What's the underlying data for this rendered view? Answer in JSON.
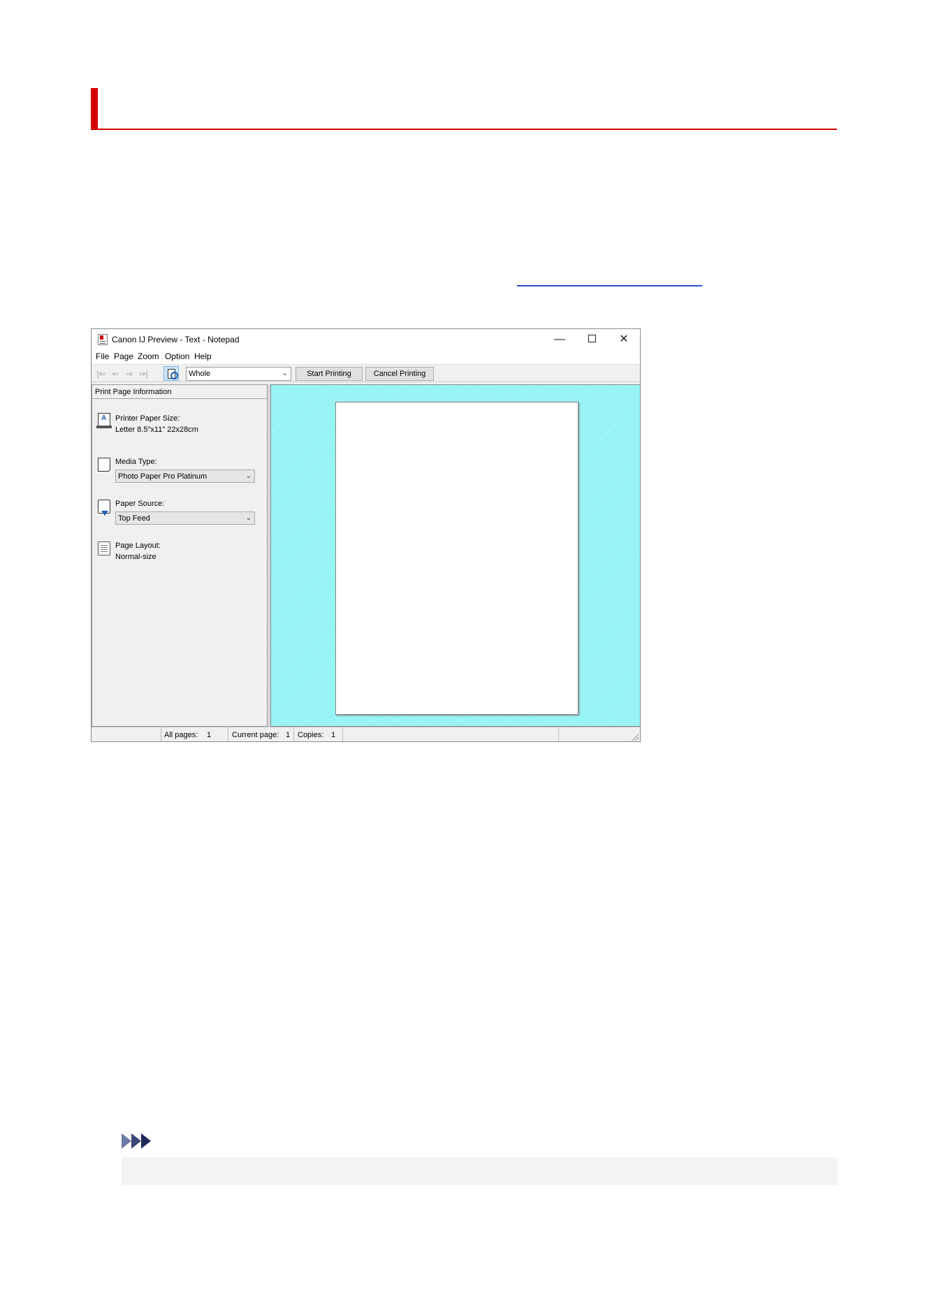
{
  "window": {
    "title": "Canon IJ Preview - Text - Notepad",
    "minimize_glyph": "—",
    "close_glyph": "✕"
  },
  "menu": [
    "File",
    "Page",
    "Zoom",
    "Option",
    "Help"
  ],
  "toolbar": {
    "nav_first": "|⇐",
    "nav_prev": "⇐",
    "nav_next": "⇒",
    "nav_last": "⇒|",
    "zoom_value": "Whole",
    "start_printing": "Start Printing",
    "cancel_printing": "Cancel Printing"
  },
  "info_panel": {
    "header": "Print Page Information",
    "printer_paper_size_label": "Printer Paper Size:",
    "printer_paper_size_value": "Letter 8.5\"x11\" 22x28cm",
    "media_type_label": "Media Type:",
    "media_type_value": "Photo Paper Pro Platinum",
    "paper_source_label": "Paper Source:",
    "paper_source_value": "Top Feed",
    "page_layout_label": "Page Layout:",
    "page_layout_value": "Normal-size"
  },
  "status_bar": {
    "all_pages_label": "All pages:",
    "all_pages_value": "1",
    "current_page_label": "Current page:",
    "current_page_value": "1",
    "copies_label": "Copies:",
    "copies_value": "1"
  },
  "colors": {
    "heading_accent": "#d40000",
    "link": "#2a4fd6",
    "preview_background": "#8ff3f3",
    "note_icon": "#1f2a5a"
  }
}
